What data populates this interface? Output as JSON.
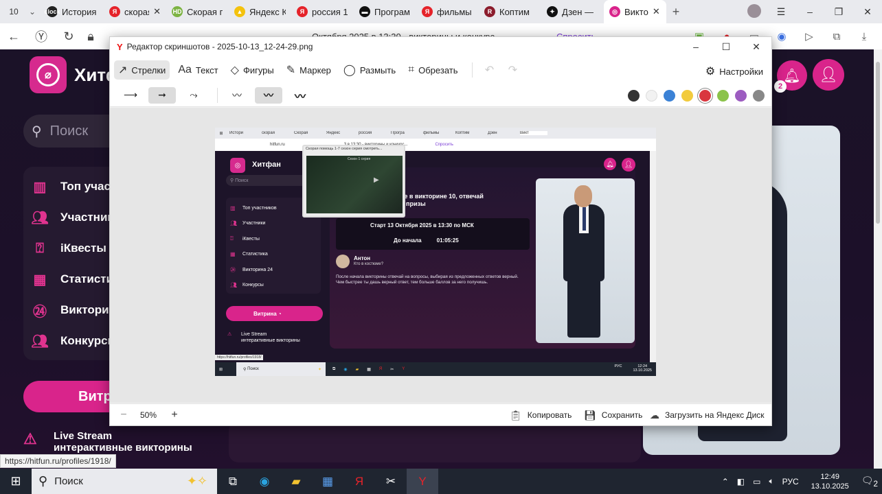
{
  "browser": {
    "tab_count": "10",
    "tabs": [
      {
        "label": "История",
        "favicon_color": "#222222",
        "favicon": "clock"
      },
      {
        "label": "скорая",
        "favicon_color": "#e5232a",
        "favicon": "Я",
        "close": "✕"
      },
      {
        "label": "Скорая г",
        "favicon_color": "#7cb342",
        "favicon": "HD"
      },
      {
        "label": "Яндекс К",
        "favicon_color": "#f4c20d",
        "favicon": "▲"
      },
      {
        "label": "россия 1",
        "favicon_color": "#e5232a",
        "favicon": "Я"
      },
      {
        "label": "Програм",
        "favicon_color": "#111111",
        "favicon": "▬"
      },
      {
        "label": "фильмы",
        "favicon_color": "#e5232a",
        "favicon": "Я"
      },
      {
        "label": "Коптим",
        "favicon_color": "#8b1c2c",
        "favicon": "R"
      },
      {
        "label": "Дзен —",
        "favicon_color": "#111111",
        "favicon": "✦"
      },
      {
        "label": "Викто",
        "favicon_color": "#d9248b",
        "favicon": "◎",
        "close": "✕"
      }
    ],
    "address_text": "Октября 2025 в 13:30 - викторины и конкурс",
    "ask_label": "Спросить"
  },
  "page": {
    "brand": "Хитфан",
    "search_placeholder": "Поиск",
    "nav": [
      {
        "label": "Топ участ"
      },
      {
        "label": "Участник"
      },
      {
        "label": "iКвесты"
      },
      {
        "label": "Статисти"
      },
      {
        "label": "Виктори"
      },
      {
        "label": "Конкурсы"
      }
    ],
    "vitrina": "Витр",
    "live_stream_title": "Live Stream",
    "live_stream_sub": "интерактивные викторины",
    "notification_count": "2",
    "status_url": "https://hitfun.ru/profiles/1918/"
  },
  "editor": {
    "title": "Редактор скриншотов - 2025-10-13_12-24-29.png",
    "tools": [
      {
        "label": "Стрелки",
        "icon": "arrow-icon",
        "glyph": "↗",
        "selected": true
      },
      {
        "label": "Текст",
        "icon": "text-icon",
        "glyph": "Aa",
        "selected": false
      },
      {
        "label": "Фигуры",
        "icon": "shapes-icon",
        "glyph": "◇",
        "selected": false
      },
      {
        "label": "Маркер",
        "icon": "marker-icon",
        "glyph": "✎",
        "selected": false
      },
      {
        "label": "Размыть",
        "icon": "blur-icon",
        "glyph": "◯",
        "selected": false
      },
      {
        "label": "Обрезать",
        "icon": "crop-icon",
        "glyph": "⌗",
        "selected": false
      }
    ],
    "settings_label": "Настройки",
    "colors": [
      "#333333",
      "#f2f2f2",
      "#3b82d6",
      "#f2cb3d",
      "#d9363e",
      "#8bc34a",
      "#9c5cc0",
      "#888888"
    ],
    "selected_color_index": 4,
    "zoom": "50%",
    "copy_label": "Копировать",
    "save_label": "Сохранить",
    "upload_label": "Загрузить на Яндекс Диск"
  },
  "shot": {
    "tabs": [
      "Истори",
      "скорая",
      "Скорая",
      "Яндекс",
      "россия",
      "Програ",
      "фильмы",
      "Коптим",
      "Дзен",
      "Викт"
    ],
    "address": "hitfun.ru",
    "address_tail": "3 в 13:30 - викторины и конкурс...",
    "ask": "Спросить",
    "video_title": "Скорая помощь 1-7 сезон серия смотреть...",
    "video_subtitle": "Сезон 1 серия",
    "brand": "Хитфан",
    "search": "Поиск",
    "nav": [
      "Топ участников",
      "Участники",
      "iКвесты",
      "Статистика",
      "Викторина 24",
      "Конкурсы"
    ],
    "vitrina": "Витрина",
    "live_title": "Live Stream",
    "live_sub": "интерактивные викторины",
    "question_line1": "ве в викторине 10, отвечай",
    "question_line2": "й призы",
    "start_line": "Старт 13 Октября 2025 в 13:30 по МСК",
    "countdown_label": "До начала",
    "countdown": "01:05:25",
    "user_name": "Антон",
    "user_sub": "Кто в костюме?",
    "description": "После начала викторины отвечай на вопросы, выбирая из предложенных ответов верный. Чем быстрее ты дашь верный ответ, тем больше баллов за него получишь.",
    "status_url": "https://hitfun.ru/profiles/1918/",
    "taskbar_search": "Поиск",
    "lang": "РУС",
    "time": "12:24",
    "date": "13.10.2025"
  },
  "taskbar": {
    "search_label": "Поиск",
    "lang": "РУС",
    "time": "12:49",
    "date": "13.10.2025",
    "notifications": "2"
  }
}
